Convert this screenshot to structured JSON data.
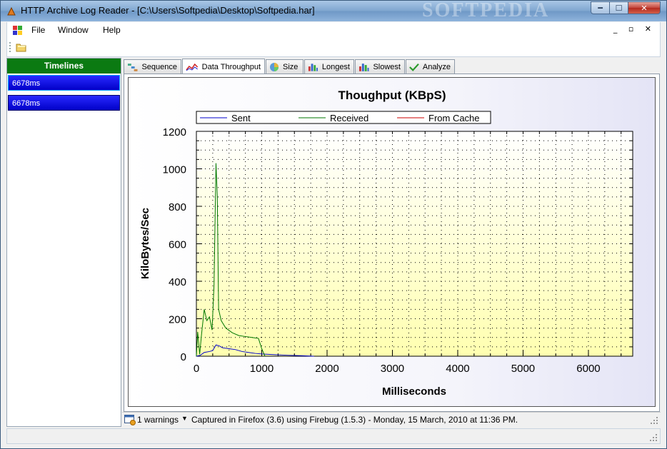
{
  "window": {
    "title": "HTTP Archive Log Reader - [C:\\Users\\Softpedia\\Desktop\\Softpedia.har]",
    "watermark": "SOFTPEDIA",
    "min_label": "━",
    "max_label": "☐",
    "close_label": "✕"
  },
  "menu": {
    "items": [
      "File",
      "Window",
      "Help"
    ],
    "mdi_controls": "_ ▫ ✕"
  },
  "sidebar": {
    "header": "Timelines",
    "items": [
      "6678ms",
      "6678ms"
    ]
  },
  "tabs": [
    {
      "label": "Sequence",
      "icon": "sequence-icon"
    },
    {
      "label": "Data Throughput",
      "icon": "throughput-icon",
      "active": true
    },
    {
      "label": "Size",
      "icon": "pie-icon"
    },
    {
      "label": "Longest",
      "icon": "bar-chart-icon"
    },
    {
      "label": "Slowest",
      "icon": "bar-chart-icon"
    },
    {
      "label": "Analyze",
      "icon": "check-icon"
    }
  ],
  "chart_data": {
    "type": "line",
    "title": "Thoughput (KBpS)",
    "xlabel": "Milliseconds",
    "ylabel": "KiloBytes/Sec",
    "xlim": [
      0,
      6678
    ],
    "ylim": [
      0,
      1200
    ],
    "xticks": [
      0,
      1000,
      2000,
      3000,
      4000,
      5000,
      6000
    ],
    "yticks": [
      0,
      200,
      400,
      600,
      800,
      1000,
      1200
    ],
    "grid": true,
    "legend": "top",
    "series": [
      {
        "name": "Sent",
        "color": "#0000cc",
        "x": [
          0,
          60,
          120,
          200,
          250,
          300,
          350,
          400,
          500,
          600,
          700,
          800,
          900,
          1000,
          1100,
          1200,
          1400,
          1600,
          1800
        ],
        "y": [
          0,
          5,
          20,
          25,
          30,
          60,
          55,
          45,
          40,
          35,
          25,
          20,
          15,
          12,
          10,
          8,
          5,
          3,
          0
        ]
      },
      {
        "name": "Received",
        "color": "#007700",
        "x": [
          0,
          20,
          50,
          80,
          120,
          160,
          200,
          240,
          270,
          300,
          320,
          340,
          380,
          450,
          550,
          650,
          750,
          850,
          950,
          1000,
          1050
        ],
        "y": [
          0,
          130,
          10,
          120,
          250,
          190,
          210,
          140,
          380,
          1030,
          850,
          250,
          190,
          150,
          125,
          110,
          105,
          100,
          95,
          40,
          0
        ]
      },
      {
        "name": "From Cache",
        "color": "#cc0000",
        "x": [],
        "y": []
      }
    ]
  },
  "status": {
    "warnings": "1 warnings",
    "caption": "Captured in Firefox (3.6) using Firebug (1.5.3) - Monday, 15 March, 2010 at 11:36 PM."
  }
}
